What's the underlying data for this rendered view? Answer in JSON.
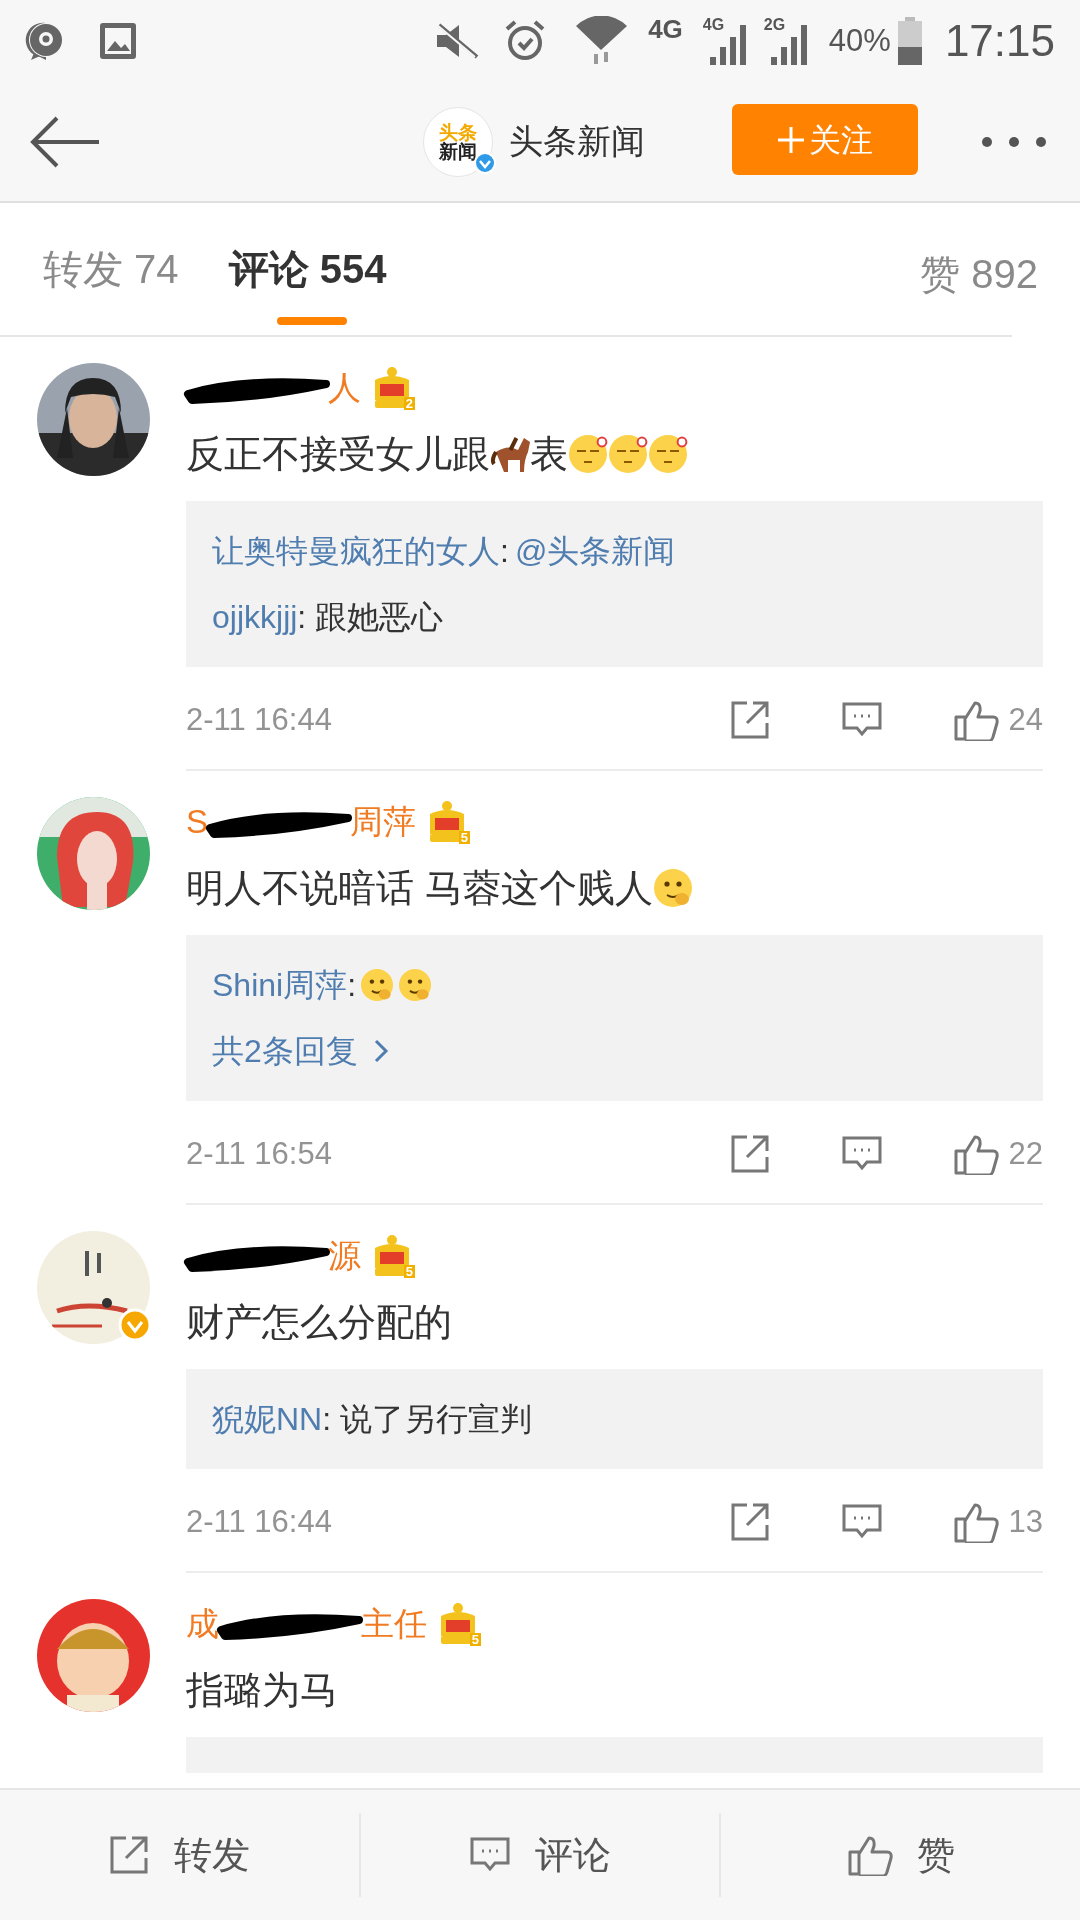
{
  "status_bar": {
    "network": "4G",
    "sim_1": "4G",
    "sim_2": "2G",
    "battery": "40%",
    "time": "17:15"
  },
  "header": {
    "logo": {
      "top": "头条",
      "bottom": "新闻",
      "verified": true
    },
    "title": "头条新闻",
    "follow_button": "关注"
  },
  "tabs": [
    {
      "label": "转发",
      "count": "74",
      "selected": false
    },
    {
      "label": "评论",
      "count": "554",
      "selected": true
    }
  ],
  "likes": {
    "label": "赞",
    "count": "892"
  },
  "comments": [
    {
      "avatar": {
        "kind": "picture",
        "verified": false
      },
      "name_parts": [
        {
          "kind": "scribble"
        },
        {
          "kind": "text",
          "text": "人"
        }
      ],
      "crown_level": "2",
      "content": [
        {
          "kind": "text",
          "text": "反正不接受女儿跟"
        },
        {
          "kind": "horse"
        },
        {
          "kind": "text",
          "text": "表"
        },
        {
          "kind": "dizzy"
        },
        {
          "kind": "dizzy"
        },
        {
          "kind": "dizzy"
        }
      ],
      "replies": [
        {
          "kind": "reply",
          "author": "让奥特曼疯狂的女人",
          "content": [
            {
              "kind": "text",
              "text": ":"
            },
            {
              "kind": "mention",
              "text": "@头条新闻"
            }
          ]
        },
        {
          "kind": "reply",
          "author": "ojjkkjjj",
          "content": [
            {
              "kind": "text",
              "text": ": 跟她恶心"
            }
          ]
        }
      ],
      "time": "2-11 16:44",
      "like_count": "24"
    },
    {
      "avatar": {
        "kind": "picture",
        "verified": false
      },
      "name_parts": [
        {
          "kind": "text",
          "text": "S"
        },
        {
          "kind": "scribble"
        },
        {
          "kind": "text",
          "text": "周萍"
        }
      ],
      "crown_level": "5",
      "content": [
        {
          "kind": "text",
          "text": "明人不说暗话 马蓉这个贱人"
        },
        {
          "kind": "thinking"
        }
      ],
      "replies": [
        {
          "kind": "reply",
          "author": "Shini周萍",
          "content": [
            {
              "kind": "text",
              "text": ":"
            },
            {
              "kind": "thinking"
            },
            {
              "kind": "thinking"
            }
          ]
        },
        {
          "kind": "more",
          "text": "共2条回复"
        }
      ],
      "time": "2-11 16:54",
      "like_count": "22"
    },
    {
      "avatar": {
        "kind": "picture",
        "verified": true
      },
      "name_parts": [
        {
          "kind": "scribble"
        },
        {
          "kind": "text",
          "text": "源"
        }
      ],
      "crown_level": "5",
      "content": [
        {
          "kind": "text",
          "text": "财产怎么分配的"
        }
      ],
      "replies": [
        {
          "kind": "reply",
          "author": "猊妮NN",
          "content": [
            {
              "kind": "text",
              "text": ": 说了另行宣判"
            }
          ]
        }
      ],
      "time": "2-11 16:44",
      "like_count": "13"
    },
    {
      "avatar": {
        "kind": "picture",
        "verified": false
      },
      "name_parts": [
        {
          "kind": "text",
          "text": "成"
        },
        {
          "kind": "scribble"
        },
        {
          "kind": "text",
          "text": "主任"
        }
      ],
      "crown_level": "5",
      "content": [
        {
          "kind": "text",
          "text": "指璐为马"
        }
      ],
      "replies_cut_off": true
    }
  ],
  "bottom_bar": [
    {
      "kind": "repost",
      "label": "转发"
    },
    {
      "kind": "comment",
      "label": "评论"
    },
    {
      "kind": "like",
      "label": "赞"
    }
  ]
}
